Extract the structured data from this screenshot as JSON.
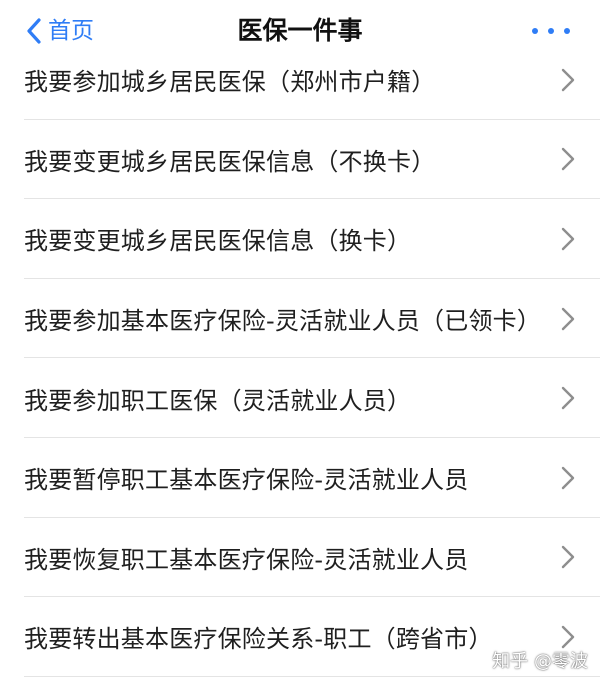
{
  "colors": {
    "accent": "#2f7df6",
    "text": "#1f1f1f",
    "divider": "#e4e4e4",
    "chevron": "#8e8e8e"
  },
  "navbar": {
    "back_label": "首页",
    "title": "医保一件事",
    "back_icon": "chevron-left-icon",
    "more_icon": "more-horizontal-icon"
  },
  "list": {
    "items": [
      {
        "label": "我要参加城乡居民医保（郑州市户籍）"
      },
      {
        "label": "我要变更城乡居民医保信息（不换卡）"
      },
      {
        "label": "我要变更城乡居民医保信息（换卡）"
      },
      {
        "label": "我要参加基本医疗保险-灵活就业人员（已领卡）"
      },
      {
        "label": "我要参加职工医保（灵活就业人员）"
      },
      {
        "label": "我要暂停职工基本医疗保险-灵活就业人员"
      },
      {
        "label": "我要恢复职工基本医疗保险-灵活就业人员"
      },
      {
        "label": "我要转出基本医疗保险关系-职工（跨省市）"
      }
    ],
    "item_icon": "chevron-right-icon"
  },
  "watermark": "知乎 @零波"
}
